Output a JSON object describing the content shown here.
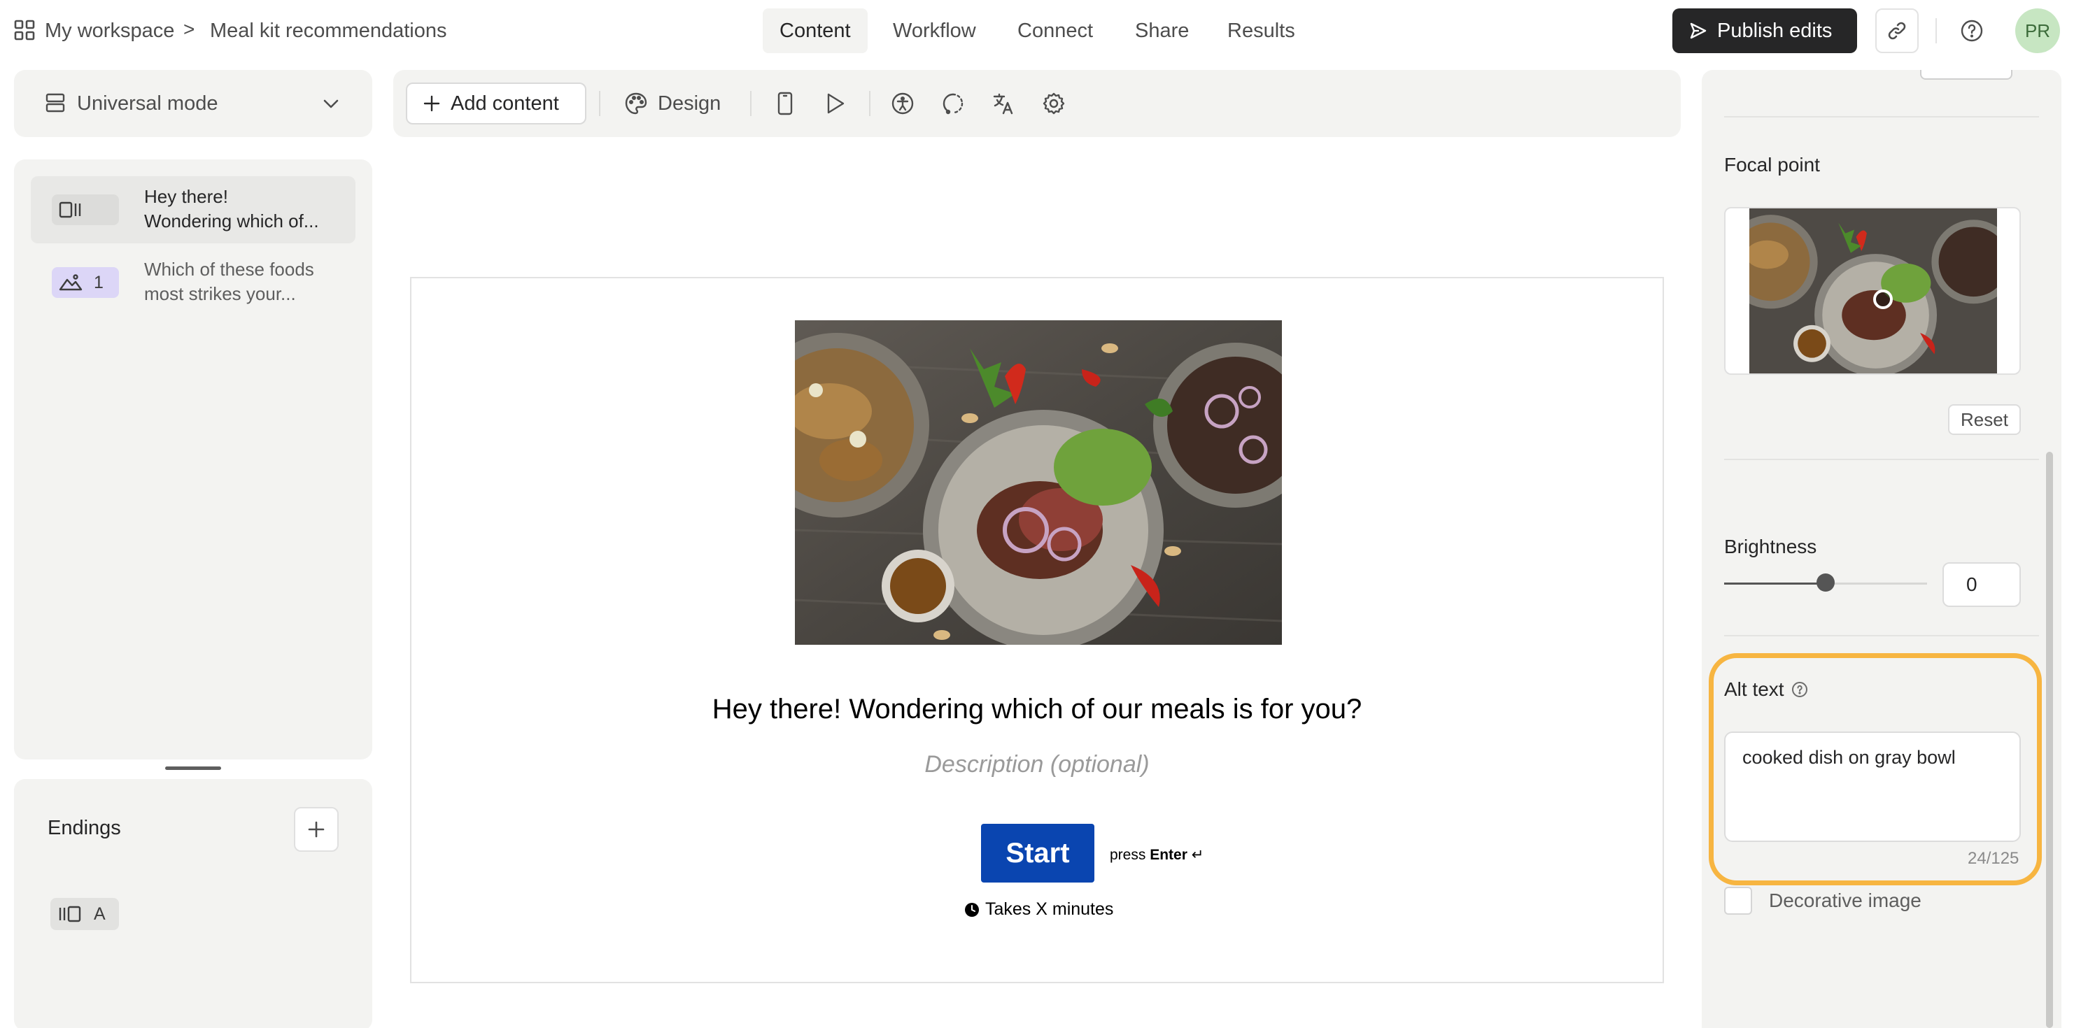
{
  "topbar": {
    "workspace": "My workspace",
    "separator": ">",
    "form_name": "Meal kit recommendations",
    "tabs": [
      {
        "label": "Content",
        "active": true
      },
      {
        "label": "Workflow",
        "active": false
      },
      {
        "label": "Connect",
        "active": false
      },
      {
        "label": "Share",
        "active": false
      },
      {
        "label": "Results",
        "active": false
      }
    ],
    "publish_label": "Publish edits",
    "avatar_initials": "PR"
  },
  "sidebar": {
    "mode_label": "Universal mode",
    "questions": [
      {
        "badge_icon": "welcome-screen-icon",
        "badge_text": "",
        "line1": "Hey there!",
        "line2": "Wondering which of...",
        "active": true
      },
      {
        "badge_icon": "picture-choice-icon",
        "badge_text": "1",
        "line1": "Which of these foods",
        "line2": "most strikes your...",
        "active": false
      }
    ],
    "endings_title": "Endings",
    "ending_badge": "A"
  },
  "toolbar": {
    "add_content_label": "Add content",
    "design_label": "Design",
    "icons": [
      "mobile-preview-icon",
      "play-icon",
      "accessibility-icon",
      "logic-icon",
      "translate-icon",
      "settings-icon"
    ]
  },
  "canvas": {
    "title": "Hey there! Wondering which of our meals is for you?",
    "description_placeholder": "Description (optional)",
    "start_label": "Start",
    "press_label": "press",
    "enter_label": "Enter",
    "enter_symbol": "↵",
    "time_note": "Takes X minutes"
  },
  "right_panel": {
    "focal_point_label": "Focal point",
    "reset_label": "Reset",
    "brightness_label": "Brightness",
    "brightness_value": "0",
    "brightness_slider_fraction": 0.5,
    "alt_text_label": "Alt text",
    "alt_text_value": "cooked dish on gray bowl",
    "alt_text_counter": "24/125",
    "decorative_label": "Decorative image",
    "decorative_checked": false
  },
  "colors": {
    "accent_highlight": "#f7b541",
    "start_button": "#0a45b0",
    "publish_button": "#262627",
    "question_badge_purple": "#dcd6f7",
    "avatar_bg": "#c7e6c2"
  }
}
